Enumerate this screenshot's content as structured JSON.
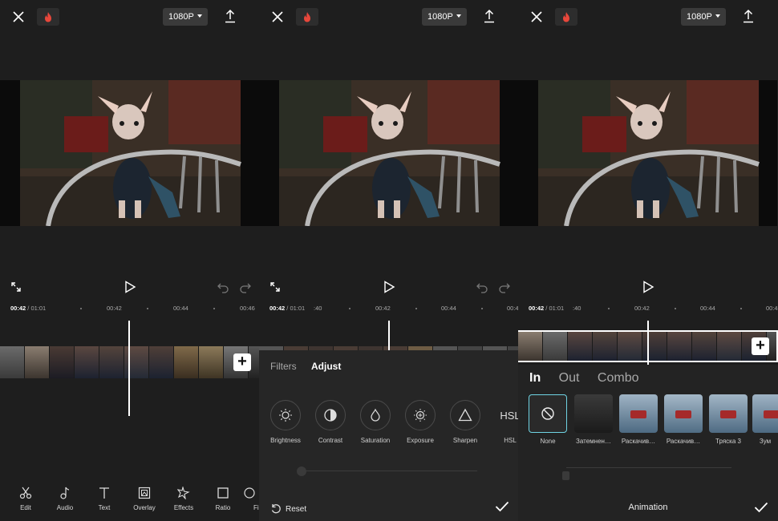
{
  "resolution": "1080P",
  "panel1": {
    "timeline": {
      "current": "00:42",
      "total": " / 01:01",
      "marks": [
        "00:42",
        "00:44",
        "00:46"
      ]
    },
    "toolbar": [
      {
        "label": "Edit",
        "icon": "scissors-icon"
      },
      {
        "label": "Audio",
        "icon": "music-note-icon"
      },
      {
        "label": "Text",
        "icon": "text-icon"
      },
      {
        "label": "Overlay",
        "icon": "overlay-icon"
      },
      {
        "label": "Effects",
        "icon": "sparkle-icon"
      },
      {
        "label": "Ratio",
        "icon": "ratio-icon"
      },
      {
        "label": "Fi",
        "icon": "filter-icon"
      }
    ]
  },
  "panel2": {
    "timeline": {
      "current": "00:42",
      "total": " / 01:01",
      "marks": [
        ":40",
        "00:42",
        "00:44",
        "00:4"
      ]
    },
    "tabs": [
      "Filters",
      "Adjust"
    ],
    "active_tab": "Adjust",
    "adjustments": [
      {
        "label": "Brightness",
        "icon": "brightness-icon"
      },
      {
        "label": "Contrast",
        "icon": "contrast-icon"
      },
      {
        "label": "Saturation",
        "icon": "saturation-icon"
      },
      {
        "label": "Exposure",
        "icon": "exposure-icon"
      },
      {
        "label": "Sharpen",
        "icon": "sharpen-icon"
      },
      {
        "label": "HSL",
        "icon": "hsl-icon"
      }
    ],
    "hsl_glyph": "HSL",
    "reset_label": "Reset"
  },
  "panel3": {
    "timeline": {
      "current": "00:42",
      "total": " / 01:01",
      "marks": [
        ":40",
        "00:42",
        "00:44",
        "00:4"
      ]
    },
    "tabs": [
      "In",
      "Out",
      "Combo"
    ],
    "active_tab": "In",
    "animations": [
      {
        "label": "None"
      },
      {
        "label": "Затемнен…"
      },
      {
        "label": "Раскачив…"
      },
      {
        "label": "Раскачив…"
      },
      {
        "label": "Тряска 3"
      },
      {
        "label": "Зум"
      }
    ],
    "footer_title": "Animation"
  },
  "colors": {
    "background": "#1e1e1e",
    "selection": "#6fd4e3",
    "sheet": "#262626"
  }
}
